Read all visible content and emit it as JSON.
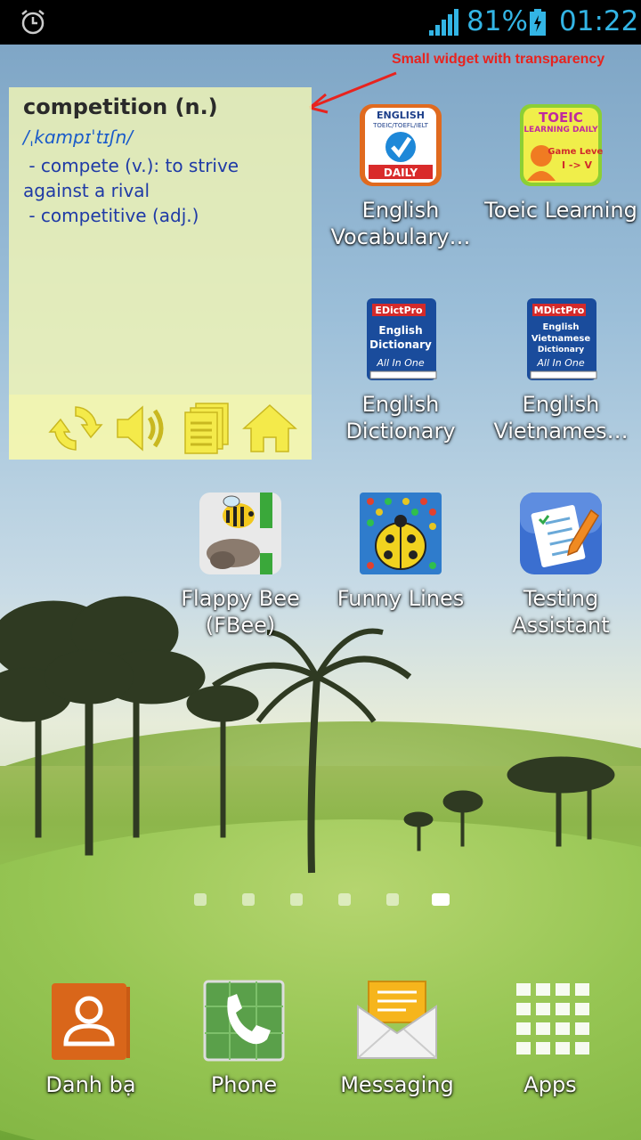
{
  "status_bar": {
    "battery_percent": "81%",
    "time": "01:22",
    "icons": [
      "alarm-icon",
      "signal-icon",
      "battery-charging-icon"
    ],
    "accent_color": "#33b5e5"
  },
  "annotation": {
    "text": "Small widget with transparency",
    "color": "#e8231e"
  },
  "widget": {
    "word": "competition (n.)",
    "phonetic": "/ˌkɑmpɪˈtɪʃn/",
    "definition": " - compete (v.): to strive against a rival\n - competitive (adj.)",
    "toolbar": [
      "refresh-icon",
      "speaker-icon",
      "list-icon",
      "home-icon"
    ]
  },
  "apps": [
    {
      "label": "English Vocabulary…",
      "icon": "english-vocabulary-daily-icon"
    },
    {
      "label": "Toeic Learning",
      "icon": "toeic-learning-daily-icon"
    },
    {
      "label": "English Dictionary",
      "icon": "edictpro-english-dictionary-icon"
    },
    {
      "label": "English Vietnames…",
      "icon": "mdictpro-english-vietnamese-icon"
    },
    {
      "label": "Flappy Bee (FBee)",
      "icon": "flappy-bee-icon"
    },
    {
      "label": "Funny Lines",
      "icon": "funny-lines-icon"
    },
    {
      "label": "Testing Assistant",
      "icon": "testing-assistant-icon"
    }
  ],
  "icon_text": {
    "vocab_top": "ENGLISH",
    "vocab_sub": "TOEIC/TOEFL/IELT",
    "vocab_bottom": "DAILY",
    "toeic_top": "TOEIC",
    "toeic_sub": "LEARNING DAILY",
    "toeic_game": "Game Level",
    "toeic_level": "I -> V",
    "edict_brand": "EDictPro",
    "edict_l1": "English",
    "edict_l2": "Dictionary",
    "edict_bottom": "All In One",
    "mdict_brand": "MDictPro",
    "mdict_l1": "English",
    "mdict_l2": "Vietnamese",
    "mdict_l3": "Dictionary",
    "mdict_bottom": "All In One"
  },
  "pages": {
    "count": 6,
    "active_index": 5
  },
  "dock": [
    {
      "label": "Danh bạ",
      "icon": "contacts-icon"
    },
    {
      "label": "Phone",
      "icon": "phone-icon"
    },
    {
      "label": "Messaging",
      "icon": "messaging-icon"
    },
    {
      "label": "Apps",
      "icon": "apps-grid-icon"
    }
  ]
}
